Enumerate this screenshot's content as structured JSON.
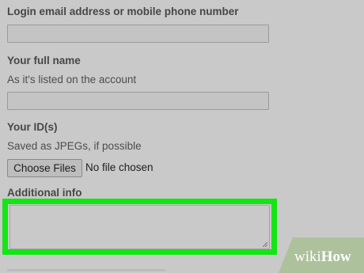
{
  "form": {
    "login": {
      "label": "Login email address or mobile phone number",
      "value": ""
    },
    "full_name": {
      "label": "Your full name",
      "hint": "As it's listed on the account",
      "value": ""
    },
    "ids": {
      "label": "Your ID(s)",
      "hint": "Saved as JPEGs, if possible",
      "choose_button": "Choose Files",
      "file_status": "No file chosen"
    },
    "additional_info": {
      "label": "Additional info",
      "value": ""
    }
  },
  "watermark": {
    "text": "wikiHow",
    "prefix": "wiki",
    "suffix": "How"
  },
  "colors": {
    "highlight": "#13e613",
    "background": "#c9c9c9"
  }
}
